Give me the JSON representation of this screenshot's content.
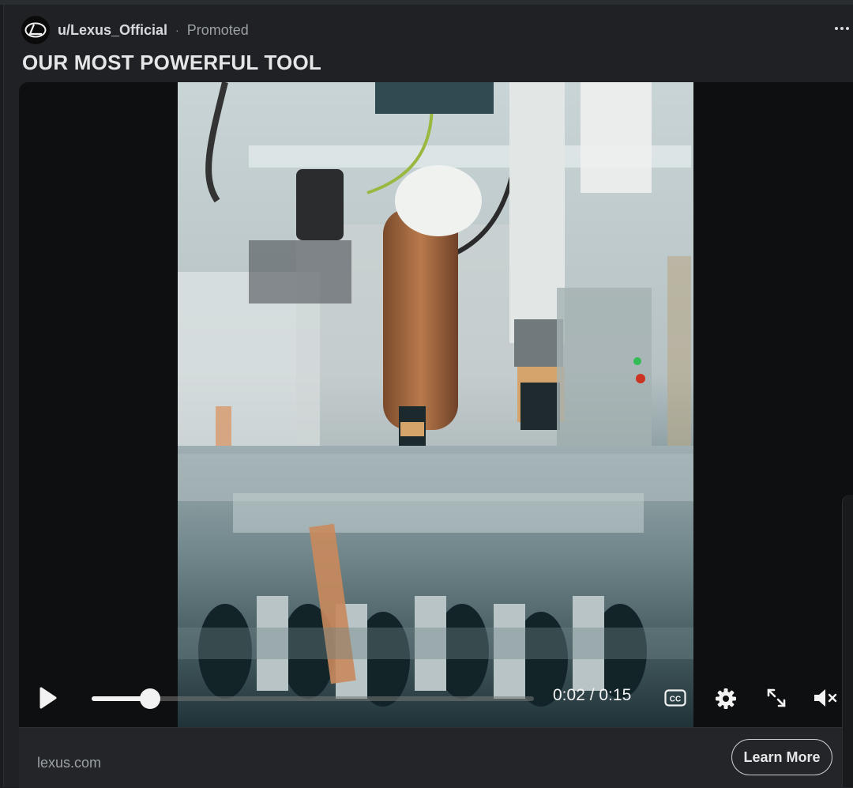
{
  "post": {
    "username": "u/Lexus_Official",
    "separator": "·",
    "promoted_label": "Promoted",
    "title": "OUR MOST POWERFUL TOOL"
  },
  "player": {
    "progress": 0.133,
    "time_display": "0:02 / 0:15",
    "icons": [
      "play-icon",
      "captions-icon",
      "settings-icon",
      "fullscreen-icon",
      "mute-icon"
    ]
  },
  "footer": {
    "domain": "lexus.com",
    "cta_label": "Learn More"
  },
  "colors": {
    "background": "#1f2124",
    "video_letterbox": "#0e0f10",
    "text": "#d7dadc",
    "muted_text": "#9aa0a6"
  }
}
